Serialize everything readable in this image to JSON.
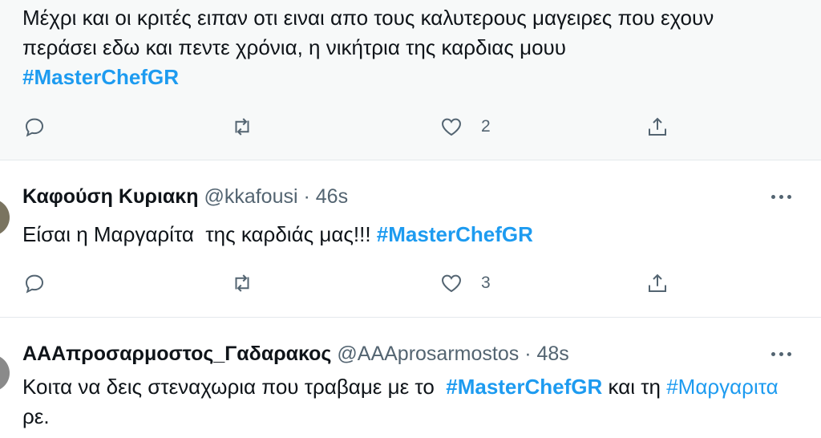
{
  "tweets": [
    {
      "text": "Μέχρι και οι κριτές ειπαν οτι ειναι απο τους καλυτερους μαγειρες που εχουν περάσει εδω και πεντε χρόνια, η νικήτρια της καρδιας μουυ",
      "hashtag": "#MasterChefGR",
      "likes": "2"
    },
    {
      "name": "Καφούση Κυριακη",
      "handle": "@kkafousi",
      "separator": "·",
      "time": "46s",
      "text": "Είσαι η Μαργαρίτα  της καρδιάς μας!!! ",
      "hashtag": "#MasterChefGR",
      "likes": "3"
    },
    {
      "name": "ΑΑΑπροσαρμοστος_Γαδαρακος",
      "handle": "@AAAprosarmostos",
      "separator": "·",
      "time": "48s",
      "text_before": "Κοιτα να δεις στεναχωρια που τραβαμε με το  ",
      "hashtag": "#MasterChefGR",
      "text_middle": " και τη ",
      "hashtag2": "#Μαργαριτα",
      "text_after": " ρε."
    }
  ],
  "icons": {
    "reply": "reply-icon",
    "retweet": "retweet-icon",
    "like": "heart-icon",
    "share": "share-icon",
    "more": "more-icon"
  },
  "colors": {
    "accent": "#1d9bf0",
    "muted": "#536471",
    "text": "#0f1419",
    "highlight_bg": "#f7f9f9"
  }
}
